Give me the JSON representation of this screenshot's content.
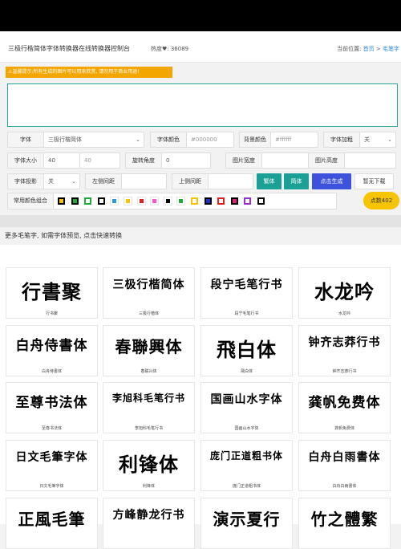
{
  "header": {
    "title": "三极行楷简体字体转换器在线转换器控制台",
    "hits": "热度♥: 36089",
    "location_label": "当前位置: ",
    "crumb_home": "首页",
    "crumb_sep": " > ",
    "crumb_current": "毛笔字"
  },
  "notice": "⚠温馨提示:所有生成的图片可以用来欣赏, 请勿用于商业用途!",
  "form": {
    "font_label": "字体",
    "font_value": "三极行楷简体",
    "color_label": "字体颜色",
    "color_placeholder": "#000000",
    "bg_label": "背景颜色",
    "bg_placeholder": "#ffffff",
    "bold_label": "字体加粗",
    "bold_value": "关",
    "size_label": "字体大小",
    "size_value": "40",
    "size_placeholder": "40",
    "rotate_label": "旋转角度",
    "rotate_value": "0",
    "width_label": "图片宽度",
    "height_label": "图片高度",
    "shadow_label": "字体投影",
    "shadow_value": "关",
    "left_spacing_label": "左侧间距",
    "top_spacing_label": "上侧间距",
    "traditional_btn": "繁体",
    "simplified_btn": "简体",
    "generate_btn": "点击生成",
    "download_btn": "暂无下载",
    "combo_label": "常用颜色组合"
  },
  "swatches": [
    {
      "fill": "#f6c400",
      "border": "#000000"
    },
    {
      "fill": "#1faa3a",
      "border": "#000000"
    },
    {
      "fill": "#ffffff",
      "border": "#1faa3a"
    },
    {
      "fill": "#ffffff",
      "border": "#000000"
    },
    {
      "fill": "#2a9ad8",
      "border": "#ffffff"
    },
    {
      "fill": "#f6c400",
      "border": "#ffffff"
    },
    {
      "fill": "#e02020",
      "border": "#ffffff"
    },
    {
      "fill": "#ff55cc",
      "border": "#ffffff"
    },
    {
      "fill": "#000000",
      "border": "#ffffff"
    },
    {
      "fill": "#1faa3a",
      "border": "#ffffff"
    },
    {
      "fill": "#ffffff",
      "border": "#f6c400"
    },
    {
      "fill": "#1e2fd0",
      "border": "#000000"
    },
    {
      "fill": "#ffffff",
      "border": "#e02020"
    },
    {
      "fill": "#e0207a",
      "border": "#000000"
    },
    {
      "fill": "#ffffff",
      "border": "#9b30d0"
    },
    {
      "fill": "#ffffff",
      "border": "#000000"
    }
  ],
  "points_btn": "点数402",
  "more_text": "更多毛笔字, 如需字体预览, 点击快速转换",
  "fonts": [
    {
      "art": "行書聚",
      "name": "行书聚"
    },
    {
      "art": "三极行楷简体",
      "name": "三极行楷体"
    },
    {
      "art": "段宁毛笔行书",
      "name": "段宁毛笔行书"
    },
    {
      "art": "水龙吟",
      "name": "水龙吟"
    },
    {
      "art": "白舟侍書体",
      "name": "白舟侍書体"
    },
    {
      "art": "春聯興体",
      "name": "春联兴体"
    },
    {
      "art": "飛白体",
      "name": "飛白体"
    },
    {
      "art": "钟齐志莽行书",
      "name": "钟齐志莽行书"
    },
    {
      "art": "至尊书法体",
      "name": "至尊书法体"
    },
    {
      "art": "李旭科毛笔行书",
      "name": "李旭科毛笔行书"
    },
    {
      "art": "国画山水字体",
      "name": "国画山水字体"
    },
    {
      "art": "龚帆免费体",
      "name": "龚帆免费体"
    },
    {
      "art": "日文毛筆字体",
      "name": "日文毛筆字体"
    },
    {
      "art": "利锋体",
      "name": "利锋体"
    },
    {
      "art": "庞门正道粗书体",
      "name": "庞门正道粗书体"
    },
    {
      "art": "白舟白雨書体",
      "name": "白舟白雨書体"
    },
    {
      "art": "正風毛筆",
      "name": ""
    },
    {
      "art": "方峰静龙行书",
      "name": ""
    },
    {
      "art": "演示夏行",
      "name": ""
    },
    {
      "art": "竹之體繁",
      "name": ""
    }
  ]
}
